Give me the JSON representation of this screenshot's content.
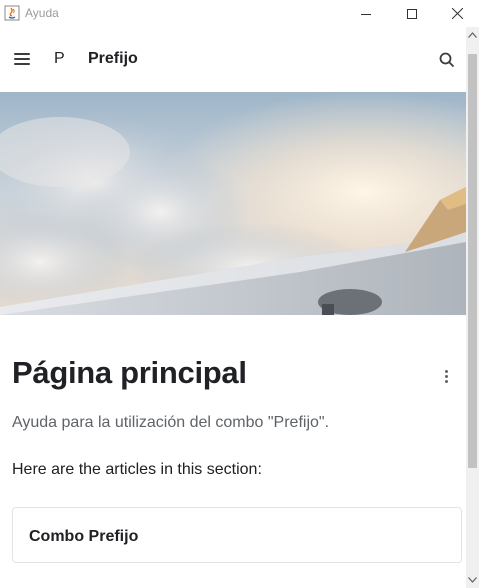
{
  "window": {
    "title": "Ayuda",
    "controls": [
      "minimize-icon",
      "maximize-icon",
      "close-icon"
    ]
  },
  "header": {
    "menu_icon": "hamburger-menu-icon",
    "logo": "P",
    "site_title": "Prefijo",
    "search_icon": "search-icon"
  },
  "hero": {
    "image": "airplane-wing-over-clouds"
  },
  "main": {
    "title": "Página principal",
    "more_icon": "more-vertical-icon",
    "description": "Ayuda para la utilización del combo \"Prefijo\".",
    "intro": "Here are the articles in this section:",
    "articles": [
      {
        "label": "Combo Prefijo"
      }
    ]
  },
  "colors": {
    "text": "#202124",
    "muted_text": "#5f6368",
    "card_border": "#e3e3e3"
  }
}
